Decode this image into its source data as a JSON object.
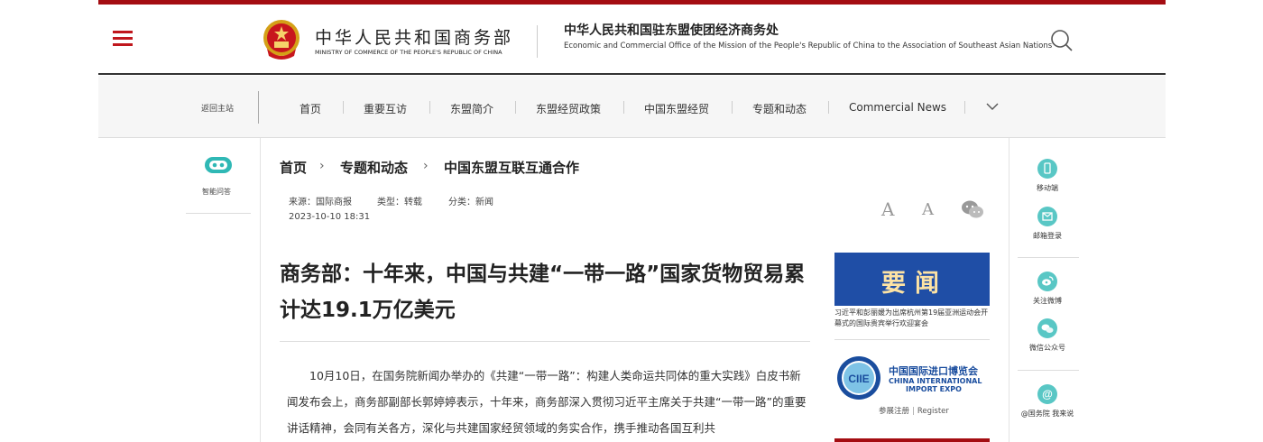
{
  "header": {
    "ministry_cn": "中华人民共和国商务部",
    "ministry_en": "MINISTRY OF COMMERCE OF THE PEOPLE'S REPUBLIC OF CHINA",
    "office_cn": "中华人民共和国驻东盟使团经济商务处",
    "office_en": "Economic and Commercial Office of the Mission of the People's Republic of China to the Association of Southeast Asian Nations",
    "accent_color": "#a40d12"
  },
  "nav": {
    "back_home": "返回主站",
    "items": [
      "首页",
      "重要互访",
      "东盟简介",
      "东盟经贸政策",
      "中国东盟经贸",
      "专题和动态",
      "Commercial News"
    ]
  },
  "left_aside": {
    "robot_label": "智能问答"
  },
  "breadcrumb": [
    "首页",
    "专题和动态",
    "中国东盟互联互通合作"
  ],
  "meta": {
    "source": "来源：国际商报",
    "type": "类型：转载",
    "category": "分类：新闻",
    "date": "2023-10-10 18:31"
  },
  "article": {
    "title": "商务部：十年来，中国与共建“一带一路”国家货物贸易累计达19.1万亿美元",
    "paragraph": "10月10日，在国务院新闻办举办的《共建“一带一路”：构建人类命运共同体的重大实践》白皮书新闻发布会上，商务部副部长郭婷婷表示，十年来，商务部深入贯彻习近平主席关于共建“一带一路”的重要讲话精神，会同有关各方，深化与共建国家经贸领域的务实合作，携手推动各国互利共"
  },
  "sidebar": {
    "news_banner": "要闻",
    "news_caption": "习近平和彭丽媛为出席杭州第19届亚洲运动会开幕式的国际贵宾举行欢迎宴会",
    "ciie_cn": "中国国际进口博览会",
    "ciie_en1": "CHINA INTERNATIONAL",
    "ciie_en2": "IMPORT EXPO",
    "ciie_logo_text": "CIIE",
    "ciie_link1": "参展注册",
    "ciie_link2": "Register"
  },
  "right_tools": [
    {
      "label": "移动端",
      "icon": "mobile-icon"
    },
    {
      "label": "邮箱登录",
      "icon": "mail-icon"
    },
    {
      "label": "关注微博",
      "icon": "weibo-icon"
    },
    {
      "label": "微信公众号",
      "icon": "wechat-icon"
    },
    {
      "label": "@国务院 我来说",
      "icon": "at-icon"
    }
  ],
  "font_controls": {
    "large": "A",
    "small": "A"
  }
}
